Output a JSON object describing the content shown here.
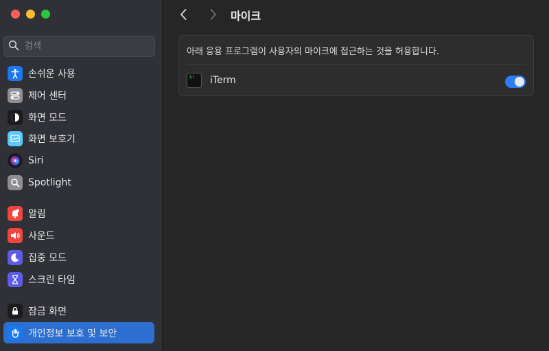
{
  "window": {
    "traffic_lights": {
      "close": "#fe5f57",
      "minimize": "#febc2e",
      "maximize": "#28c840"
    }
  },
  "sidebar": {
    "search": {
      "placeholder": "검색",
      "value": ""
    },
    "items": [
      {
        "label": "손쉬운 사용",
        "icon": "accessibility-icon",
        "color": "#1b78f2"
      },
      {
        "label": "제어 센터",
        "icon": "control-center-icon",
        "color": "#8e8e93"
      },
      {
        "label": "화면 모드",
        "icon": "appearance-icon",
        "color": "#1c1c1e"
      },
      {
        "label": "화면 보호기",
        "icon": "screen-saver-icon",
        "color": "#5ac8fa"
      },
      {
        "label": "Siri",
        "icon": "siri-icon",
        "color": "#6e3bd6"
      },
      {
        "label": "Spotlight",
        "icon": "spotlight-icon",
        "color": "#8e8e93"
      },
      {
        "label": "알림",
        "icon": "notifications-icon",
        "color": "#f2453d"
      },
      {
        "label": "사운드",
        "icon": "sound-icon",
        "color": "#f2453d"
      },
      {
        "label": "집중 모드",
        "icon": "focus-icon",
        "color": "#5e5ce6"
      },
      {
        "label": "스크린 타임",
        "icon": "screen-time-icon",
        "color": "#5e5ce6"
      },
      {
        "label": "잠금 화면",
        "icon": "lock-screen-icon",
        "color": "#1c1c1e"
      },
      {
        "label": "개인정보 보호 및 보안",
        "icon": "privacy-hand-icon",
        "color": "#1b78f2",
        "selected": true
      }
    ]
  },
  "toolbar": {
    "back": "back-chevron-icon",
    "forward": "forward-chevron-icon",
    "title": "마이크"
  },
  "main": {
    "description": "아래 응용 프로그램이 사용자의 마이크에 접근하는 것을 허용합니다.",
    "apps": [
      {
        "name": "iTerm",
        "icon_text": "$!",
        "enabled": true
      }
    ]
  },
  "colors": {
    "accent": "#2c6fd1",
    "toggle_on": "#2f7cf6"
  }
}
